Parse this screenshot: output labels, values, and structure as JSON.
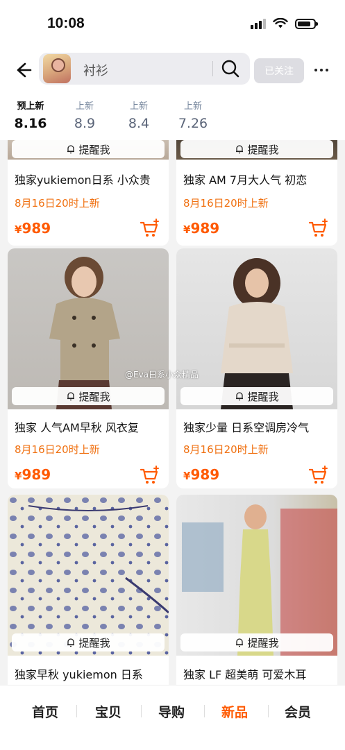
{
  "status_bar": {
    "time": "10:08"
  },
  "header": {
    "search_text": "衬衫",
    "follow_label": "已关注"
  },
  "tabs": [
    {
      "label": "预上新",
      "date": "8.16",
      "active": true
    },
    {
      "label": "上新",
      "date": "8.9"
    },
    {
      "label": "上新",
      "date": "8.4"
    },
    {
      "label": "上新",
      "date": "7.26"
    }
  ],
  "products": [
    {
      "title": "独家yukiemon日系 小众贵",
      "launch": "8月16日20时上新",
      "currency": "¥",
      "price": "989",
      "remind_label": "提醒我"
    },
    {
      "title": "独家 AM 7月大人气 初恋",
      "launch": "8月16日20时上新",
      "currency": "¥",
      "price": "989",
      "remind_label": "提醒我"
    },
    {
      "title": "独家 人气AM早秋 风衣复",
      "launch": "8月16日20时上新",
      "currency": "¥",
      "price": "989",
      "remind_label": "提醒我"
    },
    {
      "title": "独家少量 日系空调房冷气",
      "launch": "8月16日20时上新",
      "currency": "¥",
      "price": "989",
      "remind_label": "提醒我"
    },
    {
      "title": "独家早秋 yukiemon 日系",
      "launch": "",
      "currency": "",
      "price": "",
      "remind_label": "提醒我"
    },
    {
      "title": "独家 LF 超美萌 可爱木耳",
      "launch": "",
      "currency": "",
      "price": "",
      "remind_label": "提醒我"
    }
  ],
  "watermark": "@Eva日系小众精品",
  "bottom_nav": [
    {
      "label": "首页"
    },
    {
      "label": "宝贝"
    },
    {
      "label": "导购"
    },
    {
      "label": "新品",
      "active": true
    },
    {
      "label": "会员"
    }
  ],
  "colors": {
    "accent": "#ff5a00",
    "launch_text": "#f07010"
  }
}
